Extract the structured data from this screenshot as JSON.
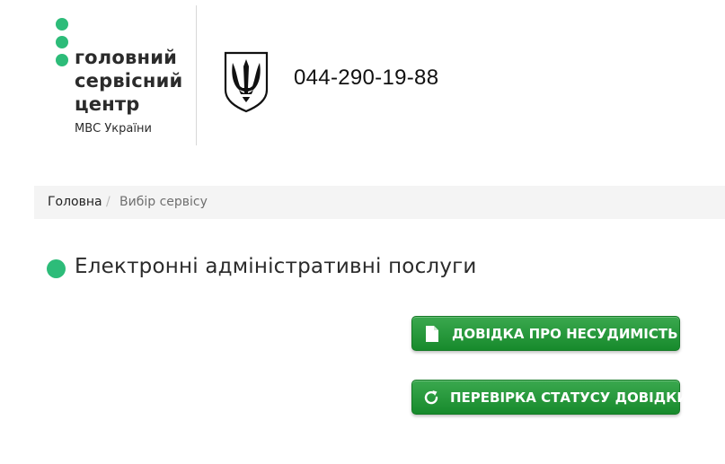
{
  "header": {
    "logo": {
      "line1": "головний",
      "line2": "сервісний",
      "line3": "центр",
      "sub": "МВС України"
    },
    "phone": "044-290-19-88"
  },
  "breadcrumb": {
    "home": "Головна",
    "separator": "/",
    "current": "Вибір сервісу"
  },
  "section": {
    "title": "Електронні адміністративні послуги"
  },
  "buttons": [
    {
      "label": "ДОВІДКА ПРО НЕСУДИМІСТЬ",
      "icon": "document-icon"
    },
    {
      "label": "ПЕРЕВІРКА СТАТУСУ ДОВІДКИ",
      "icon": "refresh-icon"
    }
  ],
  "colors": {
    "brand_green": "#2dbc79",
    "button_green": "#1f9436",
    "breadcrumb_bg": "#f4f4f4"
  }
}
